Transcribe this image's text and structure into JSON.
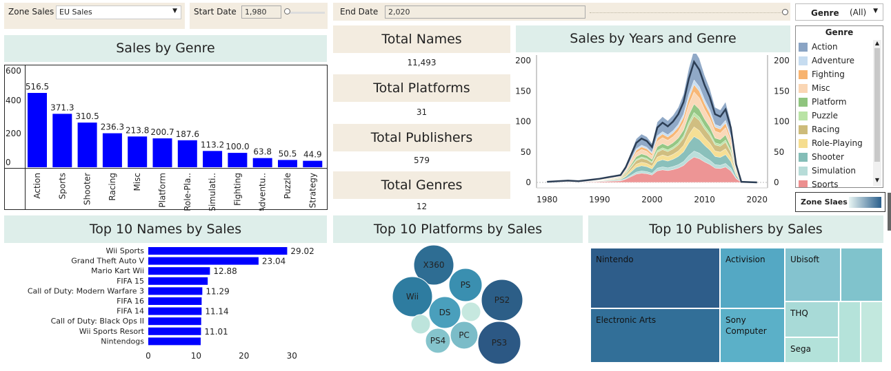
{
  "filters": {
    "zone_label": "Zone Sales",
    "zone_value": "EU Sales",
    "start_label": "Start Date",
    "start_value": "1,980",
    "end_label": "End Date",
    "end_value": "2,020",
    "genre_label": "Genre",
    "genre_value": "(All)"
  },
  "kpis": [
    {
      "title": "Total Names",
      "value": "11,493"
    },
    {
      "title": "Total Platforms",
      "value": "31"
    },
    {
      "title": "Total Publishers",
      "value": "579"
    },
    {
      "title": "Total Genres",
      "value": "12"
    }
  ],
  "legend": {
    "title": "Genre",
    "items": [
      {
        "label": "Action",
        "color": "#8aa4c4"
      },
      {
        "label": "Adventure",
        "color": "#c6dcf0"
      },
      {
        "label": "Fighting",
        "color": "#f7b36f"
      },
      {
        "label": "Misc",
        "color": "#fad6b4"
      },
      {
        "label": "Platform",
        "color": "#8fc47e"
      },
      {
        "label": "Puzzle",
        "color": "#b9e3a5"
      },
      {
        "label": "Racing",
        "color": "#cdbb7a"
      },
      {
        "label": "Role-Playing",
        "color": "#f5dd8f"
      },
      {
        "label": "Shooter",
        "color": "#84bdb7"
      },
      {
        "label": "Simulation",
        "color": "#b7dcd8"
      },
      {
        "label": "Sports",
        "color": "#ec8f8f"
      }
    ],
    "zone_legend_label": "Zone Slaes"
  },
  "chart_data": [
    {
      "type": "bar",
      "title": "Sales by Genre",
      "categories": [
        "Action",
        "Sports",
        "Shooter",
        "Racing",
        "Misc",
        "Platform",
        "Role-Pla..",
        "Simulati..",
        "Fighting",
        "Adventu..",
        "Puzzle",
        "Strategy"
      ],
      "values": [
        516.5,
        371.3,
        310.5,
        236.3,
        213.8,
        200.7,
        187.6,
        113.2,
        100.0,
        63.8,
        50.5,
        44.9
      ],
      "value_labels": [
        "516.5",
        "371.3",
        "310.5",
        "236.3",
        "213.8",
        "200.7",
        "187.6",
        "113.2",
        "100.0",
        "63.8",
        "50.5",
        "44.9"
      ],
      "yticks": [
        "600",
        "400",
        "200",
        "0"
      ],
      "ylim": [
        0,
        600
      ],
      "color": "#0000ff"
    },
    {
      "type": "area",
      "title": "Sales by Years and Genre",
      "x": [
        1980,
        1982,
        1984,
        1986,
        1988,
        1990,
        1992,
        1994,
        1995,
        1996,
        1997,
        1998,
        1999,
        2000,
        2001,
        2002,
        2003,
        2004,
        2005,
        2006,
        2007,
        2008,
        2009,
        2010,
        2011,
        2012,
        2013,
        2014,
        2015,
        2016,
        2017,
        2020
      ],
      "totals": [
        1,
        2,
        3,
        2,
        4,
        6,
        9,
        12,
        25,
        45,
        65,
        72,
        68,
        58,
        90,
        98,
        92,
        100,
        112,
        132,
        170,
        198,
        185,
        160,
        140,
        112,
        108,
        120,
        90,
        30,
        1,
        0
      ],
      "xticks": [
        "1980",
        "1990",
        "2000",
        "2010",
        "2020"
      ],
      "yticks": [
        "200",
        "150",
        "100",
        "50",
        "0"
      ],
      "ylim": [
        0,
        200
      ],
      "xlim": [
        1978,
        2022
      ]
    },
    {
      "type": "bar",
      "title": "Top 10 Names by Sales",
      "orientation": "horizontal",
      "categories": [
        "Wii Sports",
        "Grand Theft Auto V",
        "Mario Kart Wii",
        "FIFA 15",
        "Call of Duty: Modern Warfare 3",
        "FIFA 16",
        "FIFA 14",
        "Call of Duty: Black Ops II",
        "Wii Sports Resort",
        "Nintendogs"
      ],
      "values": [
        29.02,
        23.04,
        12.88,
        12.42,
        11.29,
        11.15,
        11.14,
        11.05,
        11.01,
        10.95
      ],
      "value_labels": [
        "29.02",
        "23.04",
        "12.88",
        "",
        "11.29",
        "",
        "11.14",
        "",
        "11.01",
        ""
      ],
      "xticks": [
        "0",
        "10",
        "20",
        "30"
      ],
      "xlim": [
        0,
        34
      ],
      "color": "#0000ff"
    },
    {
      "type": "bubble",
      "title": "Top 10 Platforms by Sales",
      "labels": [
        "X360",
        "PS",
        "Wii",
        "DS",
        "PS2",
        "PS4",
        "PC",
        "PS3",
        "",
        ""
      ],
      "colors": [
        "#2e6d93",
        "#3a8fb0",
        "#2e7ca0",
        "#4a9fbc",
        "#2c5e87",
        "#85c4cc",
        "#7bbcc8",
        "#2c5884",
        "#bde4dc",
        "#c6e8df"
      ]
    },
    {
      "type": "treemap",
      "title": "Top 10 Publishers by Sales",
      "labels": [
        "Nintendo",
        "Activision",
        "Ubisoft",
        "Electronic Arts",
        "Sony Computer",
        "THQ",
        "Sega",
        "",
        "",
        ""
      ],
      "colors": [
        "#2e5d8a",
        "#54a8c4",
        "#84c3cf",
        "#326f98",
        "#5bb0c8",
        "#a8dad7",
        "#b3e2da",
        "#80c3cc",
        "#b5e3da",
        "#c2e8de"
      ]
    }
  ]
}
